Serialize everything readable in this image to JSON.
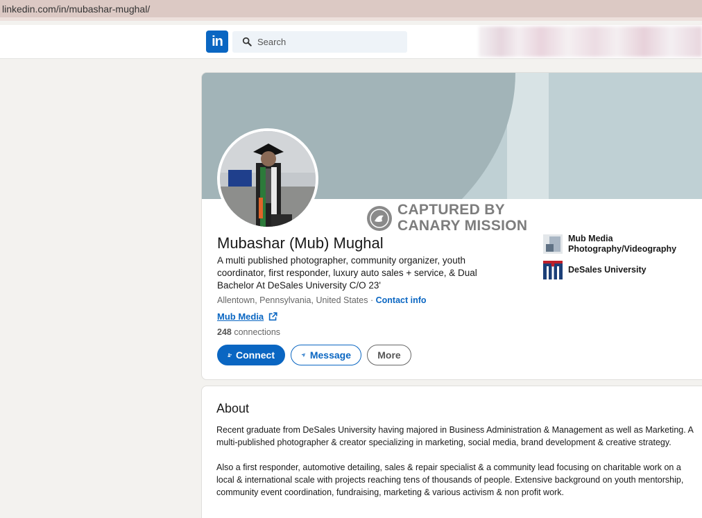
{
  "browser": {
    "url": "linkedin.com/in/mubashar-mughal/"
  },
  "nav": {
    "logo_text": "in",
    "search_placeholder": "Search"
  },
  "watermark": {
    "line1": "CAPTURED BY",
    "line2": "CANARY MISSION"
  },
  "profile": {
    "name": "Mubashar (Mub) Mughal",
    "headline": "A multi published photographer, community organizer, youth coordinator, first responder, luxury auto sales + service, & Dual Bachelor At DeSales University C/O 23'",
    "location": "Allentown, Pennsylvania, United States",
    "location_sep": " · ",
    "contact_info": "Contact info",
    "website": "Mub Media",
    "connections_count": "248",
    "connections_label": " connections",
    "buttons": {
      "connect": "Connect",
      "message": "Message",
      "more": "More"
    },
    "orgs": [
      {
        "name": "Mub Media Photography/Videography"
      },
      {
        "name": "DeSales University"
      }
    ]
  },
  "about": {
    "title": "About",
    "paragraphs": [
      "Recent graduate from DeSales University having majored in Business Administration & Management as well as Marketing. A multi-published photographer & creator specializing in marketing, social media, brand development & creative strategy.",
      "Also a first responder, automotive detailing, sales & repair specialist & a community lead focusing on charitable work on a local & international scale with projects reaching tens of thousands of people. Extensive background on youth mentorship, community event coordination, fundraising, marketing & various activism & non profit work."
    ]
  },
  "colors": {
    "accent": "#0a66c2",
    "banner": "#bfd0d4",
    "banner_arc": "#a2b4b8"
  }
}
